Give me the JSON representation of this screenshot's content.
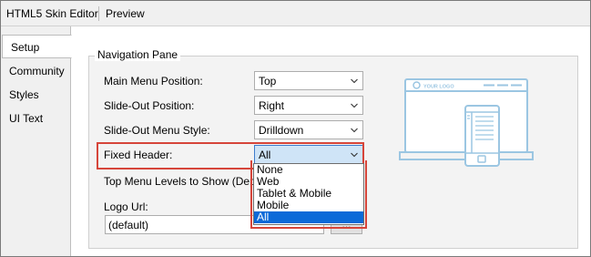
{
  "top_tabs": [
    "HTML5 Skin Editor",
    "Preview"
  ],
  "side_tabs": [
    "Setup",
    "Community",
    "Styles",
    "UI Text"
  ],
  "group_title": "Navigation Pane",
  "fields": {
    "main_menu_position": {
      "label": "Main Menu Position:",
      "value": "Top"
    },
    "slide_out_position": {
      "label": "Slide-Out Position:",
      "value": "Right"
    },
    "slide_out_menu_style": {
      "label": "Slide-Out Menu Style:",
      "value": "Drilldown"
    },
    "fixed_header": {
      "label": "Fixed Header:",
      "value": "All"
    },
    "top_menu_levels": {
      "label": "Top Menu Levels to Show (Depth)"
    },
    "logo_url": {
      "label": "Logo Url:",
      "value": "(default)",
      "browse": "..."
    }
  },
  "fixed_header_options": [
    "None",
    "Web",
    "Tablet & Mobile",
    "Mobile",
    "All"
  ],
  "fixed_header_selected": "All",
  "illustration": {
    "logo_text": "YOUR LOGO"
  },
  "colors": {
    "accent": "#0c6ad8",
    "highlight_border": "#d6453a",
    "illustration": "#9bc6e2"
  }
}
